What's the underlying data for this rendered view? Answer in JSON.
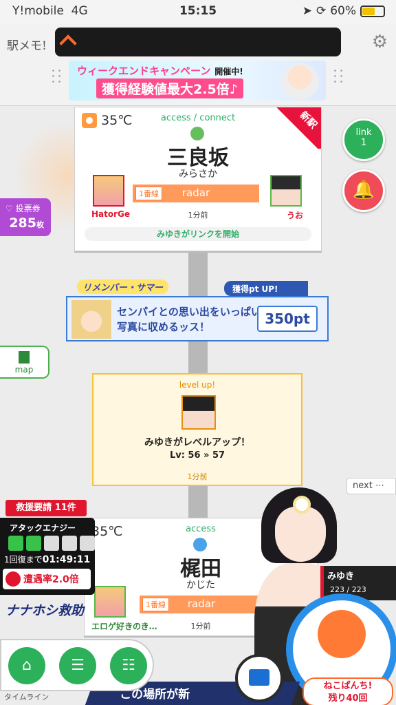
{
  "status": {
    "carrier": "Y!mobile",
    "network": "4G",
    "time": "15:15",
    "battery": "60%"
  },
  "header": {
    "logo": "駅メモ!",
    "banner_line1": "ウィークエンドキャンペーン",
    "banner_tag": "開催中!",
    "banner_line2": "獲得経験値最大2.5倍♪"
  },
  "vote": {
    "label": "投票券",
    "count": "285",
    "unit": "枚"
  },
  "station1": {
    "temp": "35℃",
    "sub": "access / connect",
    "name": "三良坂",
    "kana": "みらさか",
    "new_tag": "新駅",
    "left_user": "HatorGe",
    "right_user": "うお",
    "line": "1番線",
    "radar": "radar",
    "ago": "1分前",
    "link_text": "みゆきがリンクを開始"
  },
  "buttons": {
    "link": "link",
    "link_count": "1",
    "map": "map",
    "next": "next"
  },
  "remember": {
    "title": "リメンバー・サマー",
    "pt_up": "獲得pt UP!",
    "text": "センパイとの思い出をいっぱい写真に収めるッス！",
    "points": "350pt"
  },
  "levelup": {
    "title": "level up!",
    "message": "みゆきがレベルアップ！",
    "level": "Lv: 56 » 57",
    "ago": "1分前"
  },
  "station2": {
    "temp": "35℃",
    "sub": "access",
    "name": "梶田",
    "kana": "かじた",
    "left_user": "エロゲ好きのき…",
    "line": "1番線",
    "radar": "radar",
    "ago": "1分前"
  },
  "rescue": {
    "label": "救援要請",
    "count": "11件"
  },
  "energy": {
    "title": "アタックエナジー",
    "recover_label": "1回復まで",
    "recover_time": "01:49:11",
    "rate_label": "遭遇率",
    "rate_value": "2.0倍",
    "filled": 2,
    "total": 5
  },
  "nanahon": "ナナホシ救助",
  "character": {
    "name": "みゆき",
    "hp": "223 / 223"
  },
  "neko": {
    "line1": "ねこぱんち!",
    "line2": "残り40回"
  },
  "bottom": {
    "timeline": "タイムライン",
    "strip": "この場所が新"
  }
}
